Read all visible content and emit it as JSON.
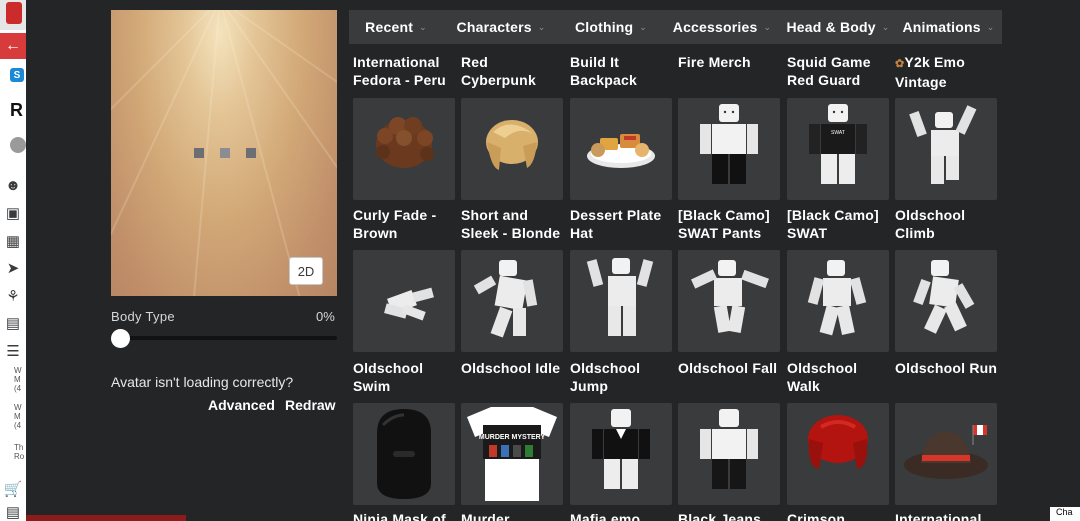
{
  "sidebar": {
    "logo_text": "R",
    "skype_text": "S",
    "icons": [
      "profile-icon",
      "inventory-icon",
      "trade-icon",
      "messages-icon",
      "friends-icon",
      "groups-icon",
      "blog-icon",
      "shop-icon",
      "gift-card-icon"
    ],
    "small_texts": [
      "W\nM\n(4",
      "W\nM\n(4",
      "Th\nRo"
    ]
  },
  "avatar": {
    "toggle_2d": "2D",
    "body_type_label": "Body Type",
    "body_type_value": "0%",
    "body_type_fraction": 0,
    "loading_message": "Avatar isn't loading correctly?",
    "advanced_label": "Advanced",
    "redraw_label": "Redraw"
  },
  "categories": [
    {
      "label": "Recent"
    },
    {
      "label": "Characters"
    },
    {
      "label": "Clothing"
    },
    {
      "label": "Accessories"
    },
    {
      "label": "Head & Body"
    },
    {
      "label": "Animations"
    }
  ],
  "rows": [
    {
      "items": [
        "International\nFedora - Peru",
        "Red\nCyberpunk",
        "Build It\nBackpack",
        "Fire Merch",
        "Squid Game\nRed Guard",
        "Y2k Emo\nVintage"
      ]
    },
    {
      "items": [
        "Curly Fade -\nBrown",
        "Short and\nSleek - Blonde",
        "Dessert Plate\nHat",
        "[Black Camo]\nSWAT Pants",
        "[Black Camo]\nSWAT",
        "Oldschool\nClimb"
      ]
    },
    {
      "items": [
        "Oldschool\nSwim",
        "Oldschool Idle",
        "Oldschool\nJump",
        "Oldschool Fall",
        "Oldschool\nWalk",
        "Oldschool Run"
      ]
    },
    {
      "items": [
        "Ninja Mask of",
        "Murder",
        "Mafia emo",
        "Black Jeans",
        "Crimson",
        "International"
      ]
    }
  ],
  "tile_icons": [
    [
      "brown-curly-hair-icon",
      "blonde-hair-icon",
      "dessert-plate-icon",
      "black-pants-avatar-icon",
      "swat-outfit-avatar-icon",
      "climb-animation-icon"
    ],
    [
      "swim-animation-icon",
      "idle-animation-icon",
      "jump-animation-icon",
      "fall-animation-icon",
      "walk-animation-icon",
      "run-animation-icon"
    ],
    [
      "ninja-mask-icon",
      "murder-mystery-shirt-icon",
      "mafia-suit-avatar-icon",
      "black-jeans-avatar-icon",
      "crimson-hair-icon",
      "canada-fedora-icon"
    ]
  ],
  "shirt_text": "MURDER MYSTERY",
  "chat_label": "Cha",
  "colors": {
    "background": "#232527",
    "tile": "#393b3d",
    "nav": "#393b3d",
    "accent_red": "#d83b3b"
  }
}
